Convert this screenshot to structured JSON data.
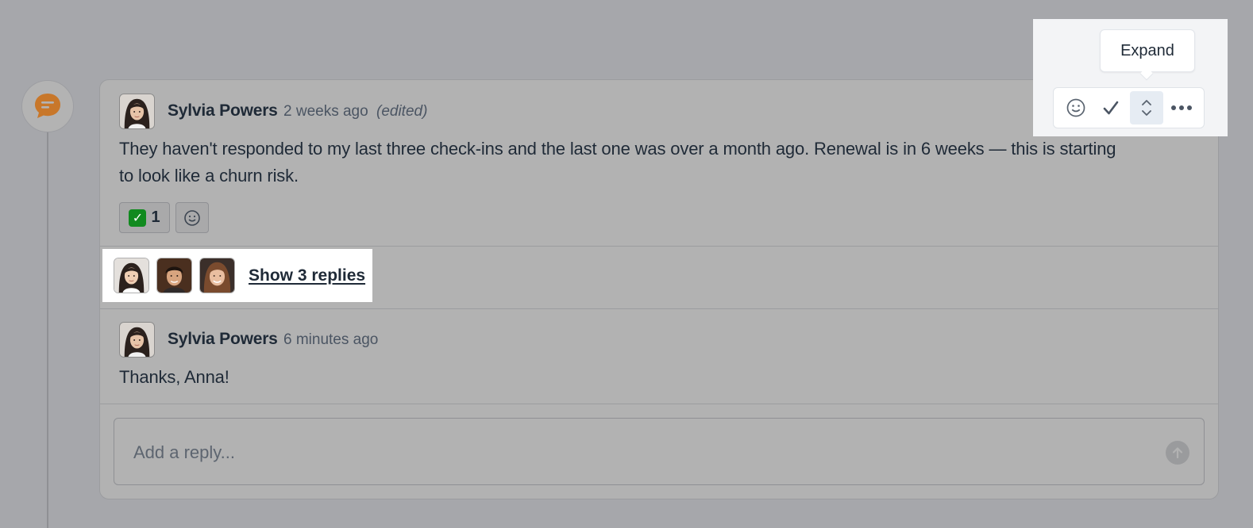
{
  "thread": {
    "main_comment": {
      "author": "Sylvia Powers",
      "time": "2 weeks ago",
      "edited_label": "(edited)",
      "line1": "They haven't responded to my last three check-ins and the last one was over a month ago. Renewal is in 6 weeks — this is starting",
      "line2": "to look like a churn risk.",
      "reaction": {
        "emoji": "✅",
        "count": "1"
      }
    },
    "replies": {
      "label": "Show 3 replies"
    },
    "latest_reply": {
      "author": "Sylvia Powers",
      "time": "6 minutes ago",
      "text": "Thanks, Anna!"
    },
    "reply_box": {
      "placeholder": "Add a reply..."
    }
  },
  "toolbar": {
    "tooltip": "Expand",
    "buttons": [
      "smiley-icon",
      "check-icon",
      "expand-icon",
      "more-icon"
    ]
  },
  "colors": {
    "accent": "#c8772a",
    "text": "#1f2a37"
  }
}
